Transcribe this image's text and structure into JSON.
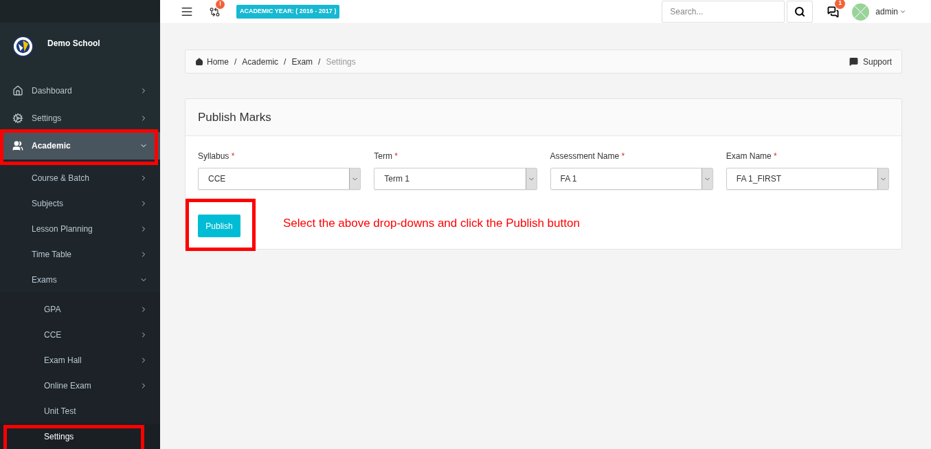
{
  "sidebar": {
    "school_name": "Demo School",
    "items": [
      {
        "label": "Dashboard",
        "kind": "folder",
        "expanded": false,
        "selected": false,
        "highlighted": false
      },
      {
        "label": "Settings",
        "kind": "folder",
        "expanded": false,
        "selected": false,
        "highlighted": false
      },
      {
        "label": "Academic",
        "kind": "folder",
        "expanded": true,
        "selected": true,
        "highlighted": true,
        "children": [
          {
            "label": "Course & Batch",
            "kind": "folder",
            "expanded": false,
            "selected": false,
            "highlighted": false
          },
          {
            "label": "Subjects",
            "kind": "folder",
            "expanded": false,
            "selected": false,
            "highlighted": false
          },
          {
            "label": "Lesson Planning",
            "kind": "folder",
            "expanded": false,
            "selected": false,
            "highlighted": false
          },
          {
            "label": "Time Table",
            "kind": "folder",
            "expanded": false,
            "selected": false,
            "highlighted": false
          },
          {
            "label": "Exams",
            "kind": "folder",
            "expanded": true,
            "selected": false,
            "highlighted": false,
            "children": [
              {
                "label": "GPA",
                "kind": "folder",
                "expanded": false,
                "selected": false,
                "highlighted": false
              },
              {
                "label": "CCE",
                "kind": "folder",
                "expanded": false,
                "selected": false,
                "highlighted": false
              },
              {
                "label": "Exam Hall",
                "kind": "folder",
                "expanded": false,
                "selected": false,
                "highlighted": false
              },
              {
                "label": "Online Exam",
                "kind": "folder",
                "expanded": false,
                "selected": false,
                "highlighted": false
              },
              {
                "label": "Unit Test",
                "kind": "link",
                "selected": false,
                "highlighted": false
              },
              {
                "label": "Settings",
                "kind": "link",
                "selected": true,
                "highlighted": true
              }
            ]
          }
        ]
      }
    ]
  },
  "topbar": {
    "updates_badge": "!",
    "academic_year": "ACADEMIC YEAR: ( 2016 - 2017 )",
    "search": {
      "placeholder": "Search..."
    },
    "messages_badge": "1",
    "user": "admin"
  },
  "breadcrumb": {
    "items": [
      {
        "label": "Home",
        "current": false
      },
      {
        "separator": "/",
        "label": "Academic",
        "current": false
      },
      {
        "separator": "/",
        "label": "Exam",
        "current": false
      },
      {
        "separator": "/",
        "label": "Settings",
        "current": true
      }
    ],
    "support": "Support"
  },
  "panel": {
    "title": "Publish Marks",
    "fields": [
      {
        "label": "Syllabus",
        "required_mark": "*",
        "value": "CCE"
      },
      {
        "label": "Term",
        "required_mark": "*",
        "value": "Term 1"
      },
      {
        "label": "Assessment Name",
        "required_mark": "*",
        "value": "FA 1"
      },
      {
        "label": "Exam Name",
        "required_mark": "*",
        "value": "FA 1_FIRST"
      }
    ],
    "publish_button": {
      "label": "Publish",
      "highlighted": true
    },
    "instruction": "Select the above drop-downs and click the Publish button"
  }
}
